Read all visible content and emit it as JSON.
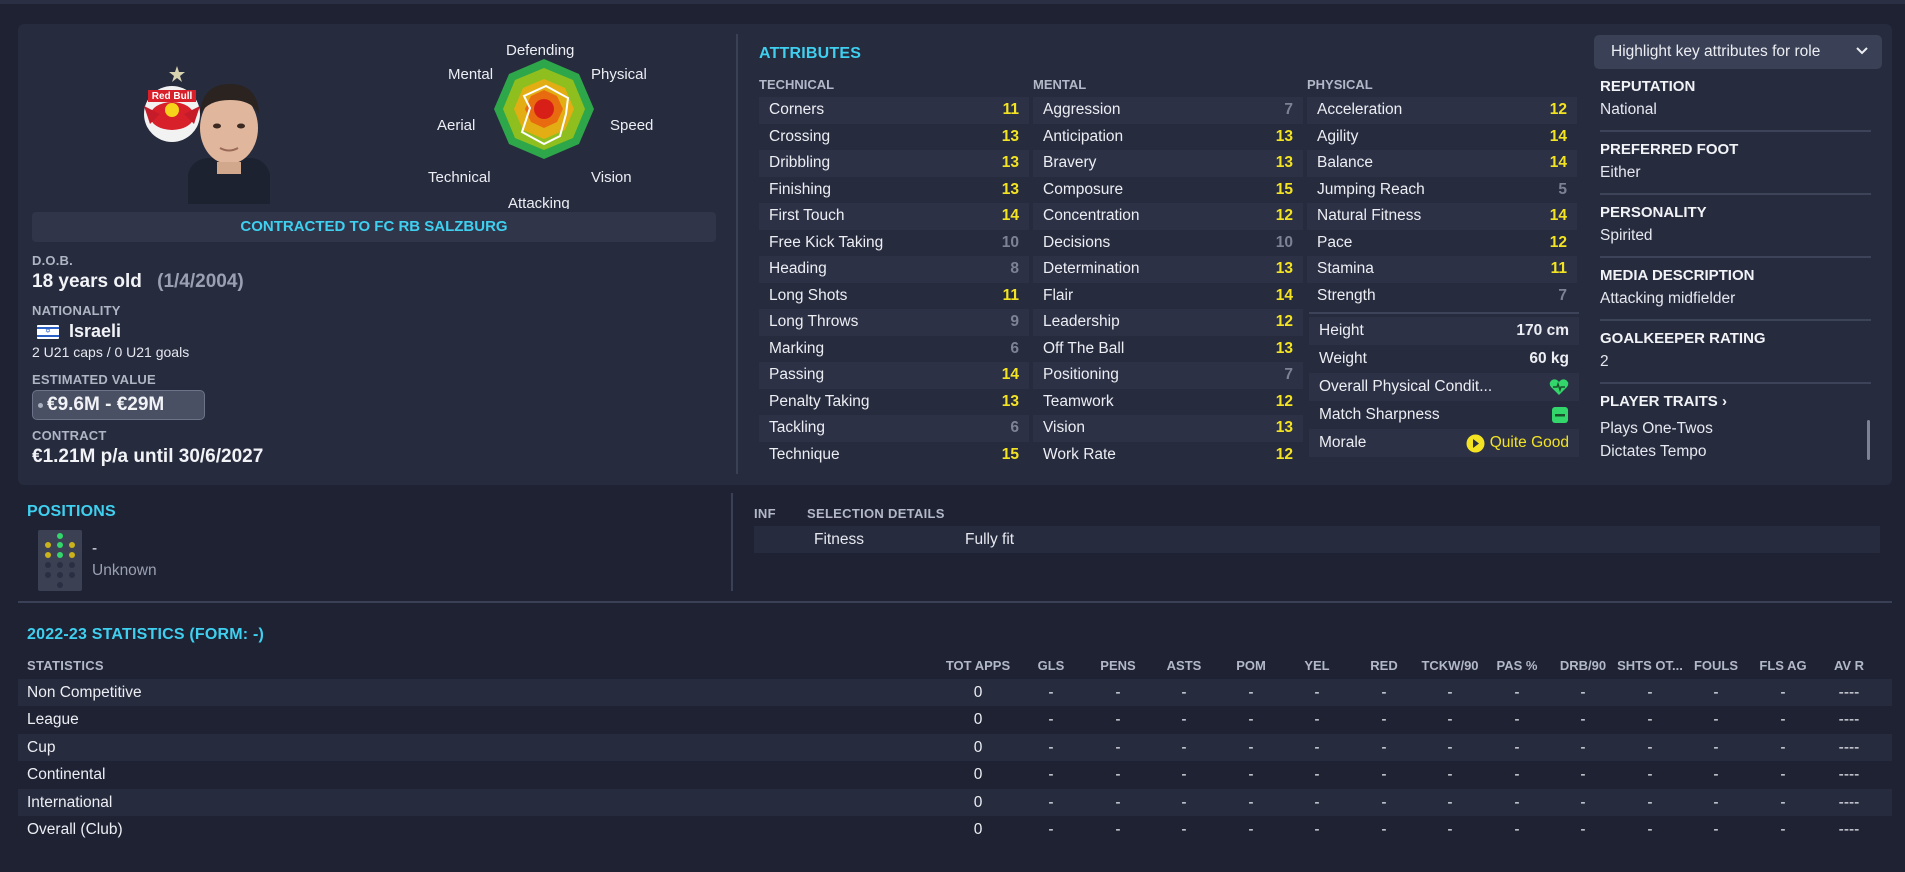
{
  "header": {
    "contract_bar": "CONTRACTED TO FC RB SALZBURG"
  },
  "profile": {
    "dob_label": "D.O.B.",
    "age": "18 years old",
    "dob": "(1/4/2004)",
    "nationality_label": "NATIONALITY",
    "nationality": "Israeli",
    "caps": "2 U21 caps / 0 U21 goals",
    "value_label": "ESTIMATED VALUE",
    "value": "€9.6M - €29M",
    "contract_label": "CONTRACT",
    "contract": "€1.21M p/a until 30/6/2027",
    "badge_text": "Red Bull"
  },
  "radar": {
    "labels": {
      "defending": "Defending",
      "physical": "Physical",
      "speed": "Speed",
      "vision": "Vision",
      "attacking": "Attacking",
      "technical": "Technical",
      "aerial": "Aerial",
      "mental": "Mental"
    },
    "colors": {
      "ring1": "#2ea64a",
      "ring2": "#8fbf1f",
      "ring3": "#e2ae13",
      "ring4": "#e86b10",
      "core": "#d81f17"
    }
  },
  "attributes": {
    "title": "ATTRIBUTES",
    "highlight_button": "Highlight key attributes for role",
    "technical_label": "TECHNICAL",
    "mental_label": "MENTAL",
    "physical_label": "PHYSICAL",
    "technical": [
      {
        "name": "Corners",
        "value": "11"
      },
      {
        "name": "Crossing",
        "value": "13"
      },
      {
        "name": "Dribbling",
        "value": "13"
      },
      {
        "name": "Finishing",
        "value": "13"
      },
      {
        "name": "First Touch",
        "value": "14"
      },
      {
        "name": "Free Kick Taking",
        "value": "10"
      },
      {
        "name": "Heading",
        "value": "8"
      },
      {
        "name": "Long Shots",
        "value": "11"
      },
      {
        "name": "Long Throws",
        "value": "9"
      },
      {
        "name": "Marking",
        "value": "6"
      },
      {
        "name": "Passing",
        "value": "14"
      },
      {
        "name": "Penalty Taking",
        "value": "13"
      },
      {
        "name": "Tackling",
        "value": "6"
      },
      {
        "name": "Technique",
        "value": "15"
      }
    ],
    "mental": [
      {
        "name": "Aggression",
        "value": "7"
      },
      {
        "name": "Anticipation",
        "value": "13"
      },
      {
        "name": "Bravery",
        "value": "13"
      },
      {
        "name": "Composure",
        "value": "15"
      },
      {
        "name": "Concentration",
        "value": "12"
      },
      {
        "name": "Decisions",
        "value": "10"
      },
      {
        "name": "Determination",
        "value": "13"
      },
      {
        "name": "Flair",
        "value": "14"
      },
      {
        "name": "Leadership",
        "value": "12"
      },
      {
        "name": "Off The Ball",
        "value": "13"
      },
      {
        "name": "Positioning",
        "value": "7"
      },
      {
        "name": "Teamwork",
        "value": "12"
      },
      {
        "name": "Vision",
        "value": "13"
      },
      {
        "name": "Work Rate",
        "value": "12"
      }
    ],
    "physical": [
      {
        "name": "Acceleration",
        "value": "12"
      },
      {
        "name": "Agility",
        "value": "14"
      },
      {
        "name": "Balance",
        "value": "14"
      },
      {
        "name": "Jumping Reach",
        "value": "5"
      },
      {
        "name": "Natural Fitness",
        "value": "14"
      },
      {
        "name": "Pace",
        "value": "12"
      },
      {
        "name": "Stamina",
        "value": "11"
      },
      {
        "name": "Strength",
        "value": "7"
      }
    ],
    "extra": {
      "height_label": "Height",
      "height": "170 cm",
      "weight_label": "Weight",
      "weight": "60 kg",
      "condition_label": "Overall Physical Condit...",
      "sharpness_label": "Match Sharpness",
      "morale_label": "Morale",
      "morale": "Quite Good"
    }
  },
  "info": {
    "reputation_label": "REPUTATION",
    "reputation": "National",
    "foot_label": "PREFERRED FOOT",
    "foot": "Either",
    "personality_label": "PERSONALITY",
    "personality": "Spirited",
    "media_label": "MEDIA DESCRIPTION",
    "media": "Attacking midfielder",
    "gk_label": "GOALKEEPER RATING",
    "gk": "2",
    "traits_label": "PLAYER TRAITS",
    "traits": [
      "Plays One-Twos",
      "Dictates Tempo"
    ]
  },
  "positions": {
    "title": "POSITIONS",
    "position": "-",
    "role": "Unknown"
  },
  "selection": {
    "inf_label": "INF",
    "details_label": "SELECTION DETAILS",
    "fitness_label": "Fitness",
    "fitness_value": "Fully fit"
  },
  "stats": {
    "title": "2022-23 STATISTICS (FORM: -)",
    "row_header": "STATISTICS",
    "columns": [
      "TOT APPS",
      "GLS",
      "PENS",
      "ASTS",
      "POM",
      "YEL",
      "RED",
      "TCKW/90",
      "PAS %",
      "DRB/90",
      "SHTS OT...",
      "FOULS",
      "FLS AG",
      "AV R"
    ],
    "rows": [
      {
        "name": "Non Competitive",
        "cells": [
          "0",
          "-",
          "-",
          "-",
          "-",
          "-",
          "-",
          "-",
          "-",
          "-",
          "-",
          "-",
          "-",
          "----"
        ]
      },
      {
        "name": "League",
        "cells": [
          "0",
          "-",
          "-",
          "-",
          "-",
          "-",
          "-",
          "-",
          "-",
          "-",
          "-",
          "-",
          "-",
          "----"
        ]
      },
      {
        "name": "Cup",
        "cells": [
          "0",
          "-",
          "-",
          "-",
          "-",
          "-",
          "-",
          "-",
          "-",
          "-",
          "-",
          "-",
          "-",
          "----"
        ]
      },
      {
        "name": "Continental",
        "cells": [
          "0",
          "-",
          "-",
          "-",
          "-",
          "-",
          "-",
          "-",
          "-",
          "-",
          "-",
          "-",
          "-",
          "----"
        ]
      },
      {
        "name": "International",
        "cells": [
          "0",
          "-",
          "-",
          "-",
          "-",
          "-",
          "-",
          "-",
          "-",
          "-",
          "-",
          "-",
          "-",
          "----"
        ]
      },
      {
        "name": "Overall (Club)",
        "cells": [
          "0",
          "-",
          "-",
          "-",
          "-",
          "-",
          "-",
          "-",
          "-",
          "-",
          "-",
          "-",
          "-",
          "----"
        ]
      }
    ]
  }
}
